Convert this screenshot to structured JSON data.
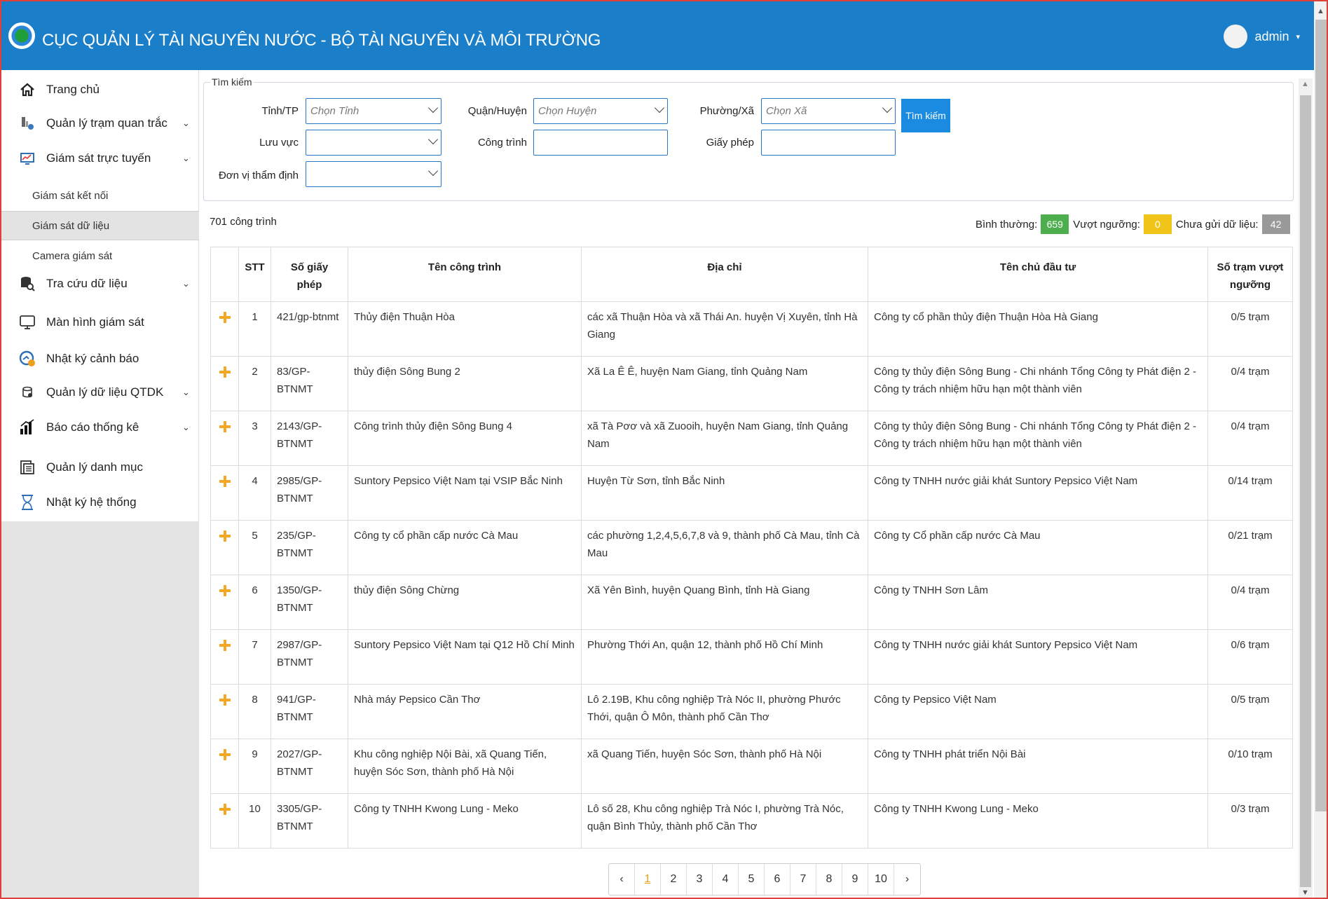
{
  "header": {
    "title": "CỤC QUẢN LÝ TÀI NGUYÊN NƯỚC - BỘ TÀI NGUYÊN VÀ MÔI TRƯỜNG",
    "user_name": "admin",
    "user_caret": "▾",
    "brand_color": "#1a7fc8"
  },
  "sidebar": {
    "items": [
      {
        "label": "Trang chủ",
        "icon": "home-icon"
      },
      {
        "label": "Quản lý trạm quan trắc",
        "icon": "station-icon",
        "chevron": "⌄"
      },
      {
        "label": "Giám sát trực tuyến",
        "icon": "monitor-chart-icon",
        "chevron": "⌄"
      },
      {
        "label": "Tra cứu dữ liệu",
        "icon": "database-search-icon",
        "chevron": "⌄"
      },
      {
        "label": "Màn hình giám sát",
        "icon": "screen-icon"
      },
      {
        "label": "Nhật ký cảnh báo",
        "icon": "alert-gauge-icon"
      },
      {
        "label": "Quản lý dữ liệu QTDK",
        "icon": "data-manage-icon",
        "chevron": "⌄"
      },
      {
        "label": "Báo cáo thống kê",
        "icon": "bar-chart-icon",
        "chevron": "⌄"
      },
      {
        "label": "Quản lý danh mục",
        "icon": "catalog-icon"
      },
      {
        "label": "Nhật ký hệ thống",
        "icon": "hourglass-icon"
      }
    ],
    "sub_items": [
      {
        "label": "Giám sát kết nối"
      },
      {
        "label": "Giám sát dữ liệu"
      },
      {
        "label": "Camera giám sát"
      }
    ]
  },
  "search": {
    "legend": "Tìm kiếm",
    "province_label": "Tỉnh/TP",
    "province_placeholder": "Chọn Tỉnh",
    "district_label": "Quận/Huyện",
    "district_placeholder": "Chọn Huyện",
    "ward_label": "Phường/Xã",
    "ward_placeholder": "Chọn Xã",
    "basin_label": "Lưu vực",
    "project_label": "Công trình",
    "license_label": "Giấy phép",
    "appraisal_label": "Đơn vị thẩm định",
    "button_label": "Tìm kiếm"
  },
  "summary": {
    "count_text": "701 công trình",
    "normal_label": "Bình thường:",
    "normal_count": "659",
    "normal_color": "#4cae4c",
    "exceed_label": "Vượt ngưỡng:",
    "exceed_count": "0",
    "exceed_color": "#f0c419",
    "nodata_label": "Chưa gửi dữ liệu:",
    "nodata_count": "42",
    "nodata_color": "#999999"
  },
  "table": {
    "headers": {
      "stt": "STT",
      "license": "Số giấy phép",
      "name": "Tên công trình",
      "address": "Địa chỉ",
      "owner": "Tên chủ đầu tư",
      "stations": "Số trạm vượt ngưỡng"
    },
    "rows": [
      {
        "stt": "1",
        "license": "421/gp-btnmt",
        "name": "Thủy điện Thuận Hòa",
        "address": "các xã Thuận Hòa và xã Thái An. huyện Vị Xuyên, tỉnh Hà Giang",
        "owner": "Công ty cổ phần thủy điện Thuận Hòa Hà Giang",
        "stations": "0/5 trạm"
      },
      {
        "stt": "2",
        "license": "83/GP-BTNMT",
        "name": "thủy điện Sông Bung 2",
        "address": "Xã La Ê Ê, huyện Nam Giang, tỉnh Quảng Nam",
        "owner": "Công ty thủy điện Sông Bung - Chi nhánh Tổng Công ty Phát điện 2 - Công ty trách nhiệm hữu hạn một thành viên",
        "stations": "0/4 trạm"
      },
      {
        "stt": "3",
        "license": "2143/GP-BTNMT",
        "name": "Công trình thủy điện Sông Bung 4",
        "address": "xã Tà Pơơ và xã Zuooih, huyện Nam Giang, tỉnh Quảng Nam",
        "owner": "Công ty thủy điện Sông Bung - Chi nhánh Tổng Công ty Phát điện 2 - Công ty trách nhiệm hữu hạn một thành viên",
        "stations": "0/4 trạm"
      },
      {
        "stt": "4",
        "license": "2985/GP-BTNMT",
        "name": "Suntory Pepsico Việt Nam tại VSIP Bắc Ninh",
        "address": "Huyện Từ Sơn, tỉnh Bắc Ninh",
        "owner": "Công ty TNHH nước giải khát Suntory Pepsico Việt Nam",
        "stations": "0/14 trạm"
      },
      {
        "stt": "5",
        "license": "235/GP-BTNMT",
        "name": "Công ty cổ phần cấp nước Cà Mau",
        "address": "các phường 1,2,4,5,6,7,8 và 9, thành phố Cà Mau, tỉnh Cà Mau",
        "owner": "Công ty Cổ phần cấp nước Cà Mau",
        "stations": "0/21 trạm"
      },
      {
        "stt": "6",
        "license": "1350/GP-BTNMT",
        "name": "thủy điện Sông Chừng",
        "address": "Xã Yên Bình, huyện Quang Bình, tỉnh Hà Giang",
        "owner": "Công ty TNHH Sơn Lâm",
        "stations": "0/4 trạm"
      },
      {
        "stt": "7",
        "license": "2987/GP-BTNMT",
        "name": "Suntory Pepsico Việt Nam tại Q12 Hồ Chí Minh",
        "address": "Phường Thới An, quận 12, thành phố Hồ Chí Minh",
        "owner": "Công ty TNHH nước giải khát Suntory Pepsico Việt Nam",
        "stations": "0/6 trạm"
      },
      {
        "stt": "8",
        "license": "941/GP-BTNMT",
        "name": "Nhà máy Pepsico Cần Thơ",
        "address": "Lô 2.19B, Khu công nghiệp Trà Nóc II, phường Phước Thới, quận Ô Môn, thành phố Cần Thơ",
        "owner": "Công ty Pepsico Việt Nam",
        "stations": "0/5 trạm"
      },
      {
        "stt": "9",
        "license": "2027/GP-BTNMT",
        "name": "Khu công nghiệp Nội Bài, xã Quang Tiến, huyện Sóc Sơn, thành phố Hà Nội",
        "address": "xã Quang Tiến, huyện Sóc Sơn, thành phố Hà Nội",
        "owner": "Công ty TNHH phát triển Nội Bài",
        "stations": "0/10 trạm"
      },
      {
        "stt": "10",
        "license": "3305/GP-BTNMT",
        "name": "Công ty TNHH Kwong Lung - Meko",
        "address": "Lô số 28, Khu công nghiệp Trà Nóc I, phường Trà Nóc, quận Bình Thủy, thành phố Cần Thơ",
        "owner": "Công ty TNHH Kwong Lung - Meko",
        "stations": "0/3 trạm"
      }
    ]
  },
  "pagination": {
    "prev": "‹",
    "pages": [
      "1",
      "2",
      "3",
      "4",
      "5",
      "6",
      "7",
      "8",
      "9",
      "10"
    ],
    "current": "1",
    "next": "›"
  }
}
